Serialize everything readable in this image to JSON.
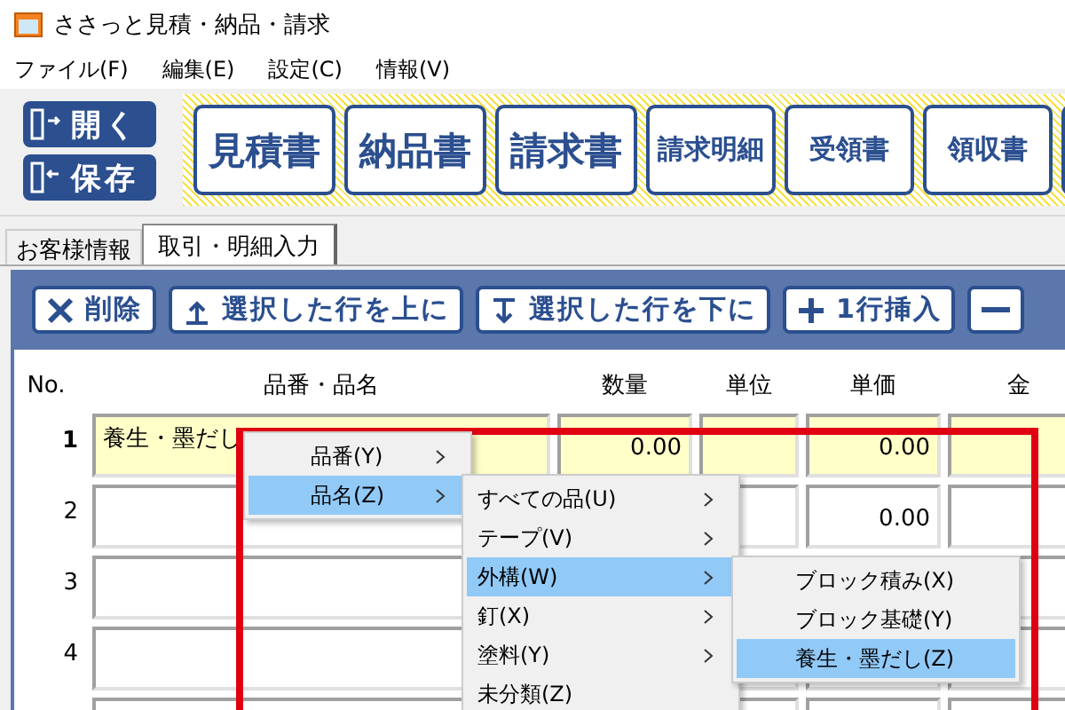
{
  "window": {
    "title": "ささっと見積・納品・請求"
  },
  "menu": [
    "ファイル(F)",
    "編集(E)",
    "設定(C)",
    "情報(V)"
  ],
  "file_buttons": [
    {
      "label": "開く",
      "kind": "open"
    },
    {
      "label": "保存",
      "kind": "save"
    }
  ],
  "document_buttons": [
    {
      "label": "見積書",
      "kind": "large"
    },
    {
      "label": "納品書",
      "kind": "large"
    },
    {
      "label": "請求書",
      "kind": "large"
    },
    {
      "label": "請求明細",
      "kind": "small"
    },
    {
      "label": "受領書",
      "kind": "small"
    },
    {
      "label": "領収書",
      "kind": "small"
    }
  ],
  "tabs": [
    {
      "label": "お客様情報",
      "selected": false
    },
    {
      "label": "取引・明細入力",
      "selected": true
    }
  ],
  "row_tools": [
    {
      "label": "削除",
      "kind": "delete"
    },
    {
      "label": "選択した行を上に",
      "kind": "up"
    },
    {
      "label": "選択した行を下に",
      "kind": "down"
    },
    {
      "label": "1行挿入",
      "kind": "insert"
    },
    {
      "kind": "remove"
    }
  ],
  "table": {
    "columns": [
      "No.",
      "品番・品名",
      "数量",
      "単位",
      "単価",
      "金"
    ],
    "rows": [
      {
        "no": "1",
        "name": "養生・墨だし",
        "quantity": "0.00",
        "unit_price": "0.00",
        "selected": true
      },
      {
        "no": "2",
        "unit_price": "0.00",
        "selected": false
      },
      {
        "no": "3",
        "selected": false
      },
      {
        "no": "4",
        "selected": false
      },
      {
        "selected": false
      }
    ]
  },
  "context_menus": [
    {
      "items": [
        {
          "label": "品番(Y)",
          "submenu": true,
          "selected": false
        },
        {
          "label": "品名(Z)",
          "submenu": true,
          "selected": true
        }
      ]
    },
    {
      "items": [
        {
          "label": "すべての品(U)",
          "submenu": true,
          "selected": false
        },
        {
          "label": "テープ(V)",
          "submenu": true,
          "selected": false
        },
        {
          "label": "外構(W)",
          "submenu": true,
          "selected": true
        },
        {
          "label": "釘(X)",
          "submenu": true,
          "selected": false
        },
        {
          "label": "塗料(Y)",
          "submenu": true,
          "selected": false
        },
        {
          "label": "未分類(Z)",
          "submenu": false,
          "selected": false
        }
      ]
    },
    {
      "items": [
        {
          "label": "ブロック積み(X)",
          "submenu": false,
          "selected": false
        },
        {
          "label": "ブロック基礎(Y)",
          "submenu": false,
          "selected": false
        },
        {
          "label": "養生・墨だし(Z)",
          "submenu": false,
          "selected": true
        }
      ]
    }
  ]
}
